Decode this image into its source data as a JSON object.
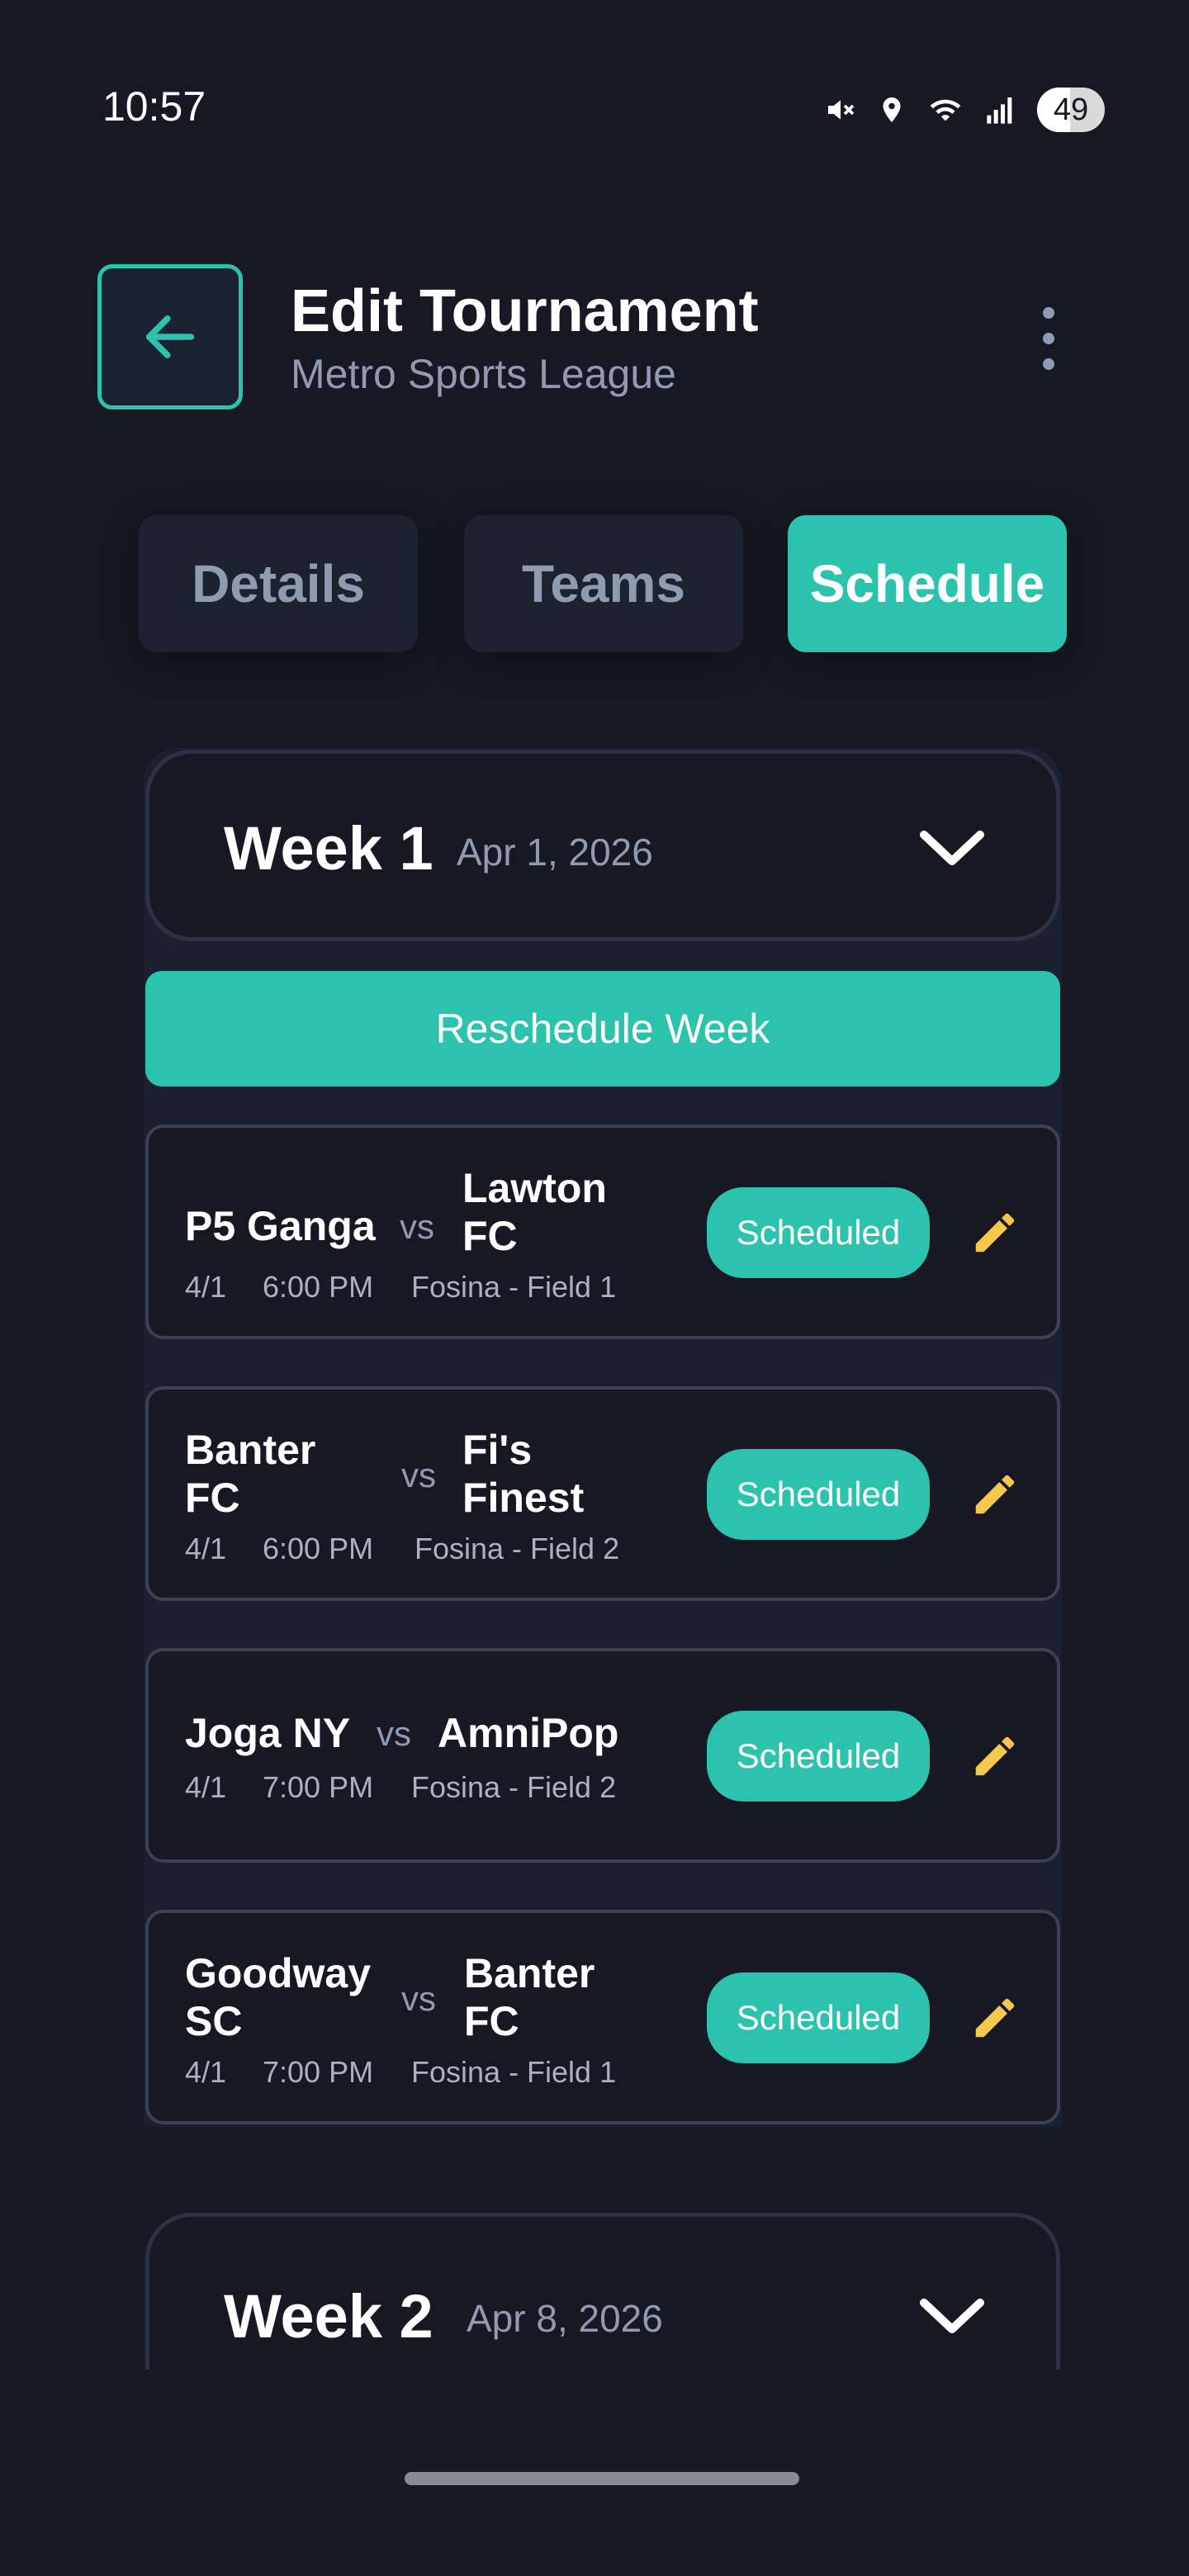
{
  "status_bar": {
    "time": "10:57",
    "battery": "49"
  },
  "header": {
    "title": "Edit Tournament",
    "subtitle": "Metro Sports League"
  },
  "tabs": [
    {
      "label": "Details",
      "active": false
    },
    {
      "label": "Teams",
      "active": false
    },
    {
      "label": "Schedule",
      "active": true
    }
  ],
  "weeks": [
    {
      "title": "Week 1",
      "date": "Apr 1, 2026",
      "reschedule_label": "Reschedule Week",
      "matches": [
        {
          "home": "P5 Ganga",
          "vs": "vs",
          "away": "Lawton FC",
          "date": "4/1",
          "time": "6:00 PM",
          "venue": "Fosina - Field 1",
          "status": "Scheduled"
        },
        {
          "home": "Banter FC",
          "vs": "vs",
          "away": "Fi's Finest",
          "date": "4/1",
          "time": "6:00 PM",
          "venue": "Fosina - Field 2",
          "status": "Scheduled"
        },
        {
          "home": "Joga NY",
          "vs": "vs",
          "away": "AmniPop",
          "date": "4/1",
          "time": "7:00 PM",
          "venue": "Fosina - Field 2",
          "status": "Scheduled"
        },
        {
          "home": "Goodway SC",
          "vs": "vs",
          "away": "Banter FC",
          "date": "4/1",
          "time": "7:00 PM",
          "venue": "Fosina - Field 1",
          "status": "Scheduled"
        }
      ]
    },
    {
      "title": "Week 2",
      "date": "Apr 8, 2026"
    }
  ],
  "icons": {
    "back": "arrow-left-icon",
    "more": "more-vertical-icon",
    "expand": "chevron-down-icon",
    "edit": "pencil-icon"
  },
  "colors": {
    "accent": "#2bc2ae",
    "background": "#181824",
    "edit_icon": "#f5c84c",
    "muted_text": "#8f9bb0"
  }
}
